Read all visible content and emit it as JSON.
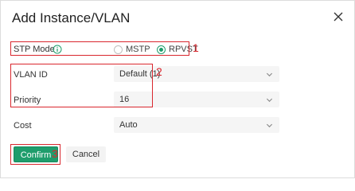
{
  "dialog": {
    "title": "Add Instance/VLAN",
    "close_icon": "close-icon"
  },
  "stp_mode": {
    "label": "STP Mode",
    "info_icon": "info-icon",
    "options": [
      {
        "label": "MSTP",
        "checked": false
      },
      {
        "label": "RPVST",
        "checked": true
      }
    ]
  },
  "vlan_id": {
    "label": "VLAN ID",
    "value": "Default (1)"
  },
  "priority": {
    "label": "Priority",
    "value": "16"
  },
  "cost": {
    "label": "Cost",
    "value": "Auto"
  },
  "buttons": {
    "confirm": "Confirm",
    "cancel": "Cancel"
  },
  "annotations": {
    "one": "1",
    "two": "2",
    "three": "3"
  },
  "colors": {
    "accent": "#1f9d6c",
    "annotation_red": "#d9272e"
  }
}
